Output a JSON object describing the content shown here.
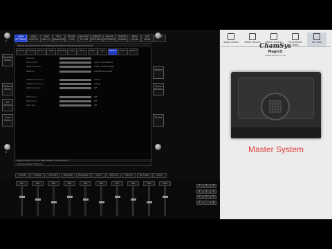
{
  "top_tabs": [
    "VIEW SETTINGS",
    "VIEW SYSTEM",
    "VIEW DMX I/O",
    "FILE MANAGER",
    "SHOW FILES",
    "BACKUP TO USB",
    "UPDATE SETTINGS",
    "GROUP SETTINGS",
    "CREATE SHOWS",
    "NEW SHOW",
    "CUE MOVE",
    "SAVE"
  ],
  "left_side": {
    "knob_top": "A",
    "label1": "Pan/Main Speed",
    "label2": "Tilt/Main Sweep",
    "label3": "Set Default",
    "label4": "Clear Colour",
    "knob_bottom": "B"
  },
  "right_side": {
    "label1": "Options",
    "label2": "Screen Window",
    "label3": "To Size",
    "knob_top": "C",
    "knob_bottom": "D"
  },
  "screen": {
    "path": "SETUP  V:\\System\\DemoConfig\\Magic\\ShowName\\Views\\System\\Setup.rtf",
    "tabs": [
      "Profiles",
      "Fixtures",
      "Record",
      "DMX",
      "Playback",
      "Colour",
      "Setup",
      "Magic",
      "Net",
      "Network",
      "Screen",
      "Options"
    ],
    "rows": [
      {
        "label": "Network",
        "value": ""
      },
      {
        "label": "Ethernet IP",
        "value": "Auto Local Network"
      },
      {
        "label": "Network Name",
        "value": "Adapt, Default/Magic"
      },
      {
        "label": "Network",
        "value": "Auto/Ethernet Raw"
      },
      {
        "label": "",
        "value": ""
      },
      {
        "label": "ArtNet Universe 1",
        "value": "Artnet"
      },
      {
        "label": "ArtNet Universe 2",
        "value": "Artnet"
      },
      {
        "label": "sACN Universe",
        "value": "Off"
      },
      {
        "label": "",
        "value": ""
      },
      {
        "label": "DMX Out 1",
        "value": "Off"
      },
      {
        "label": "DMX Out 2",
        "value": "Off"
      },
      {
        "label": "Multi Out",
        "value": "Off"
      }
    ],
    "status": "MagicQ Version 1.9.2.1  |  DMX OUTPUT: ON  |  SHOW: 0",
    "cmd": "Add/Set/Update FX/Pos/Col"
  },
  "playbacks": [
    "PB1",
    "PB2",
    "PB3",
    "PB4",
    "PB5",
    "PB6",
    "PB7",
    "PB8",
    "PB9",
    "PB10"
  ],
  "playback_labels": [
    "Pan/Tilt",
    "Dimmer",
    "Circle Fan",
    "Red Fade",
    "Blue Chase",
    "Cyan",
    "Spot Cue",
    "Main FX",
    "Fan Chase",
    "Colour"
  ],
  "keypad": [
    "7",
    "8",
    "9",
    "4",
    "5",
    "6",
    "1",
    "2",
    "3",
    "0",
    ".",
    "@"
  ],
  "right_panel": {
    "toolbar": [
      "Show Camera",
      "Select Fixtures",
      "Select Universe",
      "Fit to Whole Room",
      "Pan View"
    ],
    "logo_line1": "ChamSys",
    "logo_line2": "MagicQ",
    "logo_line3": "www.chamsys.co.uk",
    "hero_text": "Master System",
    "accent": "#e03b3b"
  }
}
